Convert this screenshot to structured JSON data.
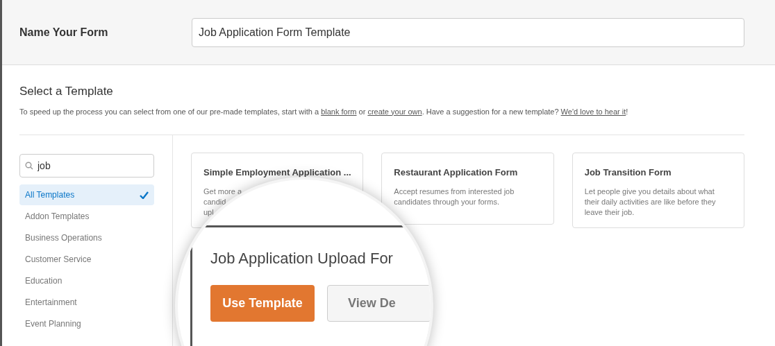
{
  "form_name": {
    "label": "Name Your Form",
    "value": "Job Application Form Template"
  },
  "section": {
    "title": "Select a Template",
    "description": [
      {
        "kind": "text",
        "text": "To speed up the process you can select from one of our pre-made templates, start with a "
      },
      {
        "kind": "link",
        "text": "blank form"
      },
      {
        "kind": "text",
        "text": " or "
      },
      {
        "kind": "link",
        "text": "create your own"
      },
      {
        "kind": "text",
        "text": ". Have a suggestion for a new template? "
      },
      {
        "kind": "link",
        "text": "We'd love to hear it"
      },
      {
        "kind": "text",
        "text": "!"
      }
    ]
  },
  "search": {
    "value": "job"
  },
  "categories": [
    {
      "label": "All Templates",
      "selected": true
    },
    {
      "label": "Addon Templates",
      "selected": false
    },
    {
      "label": "Business Operations",
      "selected": false
    },
    {
      "label": "Customer Service",
      "selected": false
    },
    {
      "label": "Education",
      "selected": false
    },
    {
      "label": "Entertainment",
      "selected": false
    },
    {
      "label": "Event Planning",
      "selected": false
    }
  ],
  "templates": [
    {
      "title": "Simple Employment Application ...",
      "description": [
        "Get more a",
        "candid",
        "upl"
      ]
    },
    {
      "title": "Restaurant Application Form",
      "description": [
        "Accept resumes from interested job",
        "candidates through your forms."
      ]
    },
    {
      "title": "Job Transition Form",
      "description": [
        "Let people give you details about what",
        "their daily activities are like before they",
        "leave their job."
      ]
    }
  ],
  "magnifier": {
    "title": "Job Application Upload For",
    "buttons": [
      {
        "kind": "primary",
        "label": "Use Template"
      },
      {
        "kind": "secondary",
        "label": "View De"
      }
    ]
  }
}
